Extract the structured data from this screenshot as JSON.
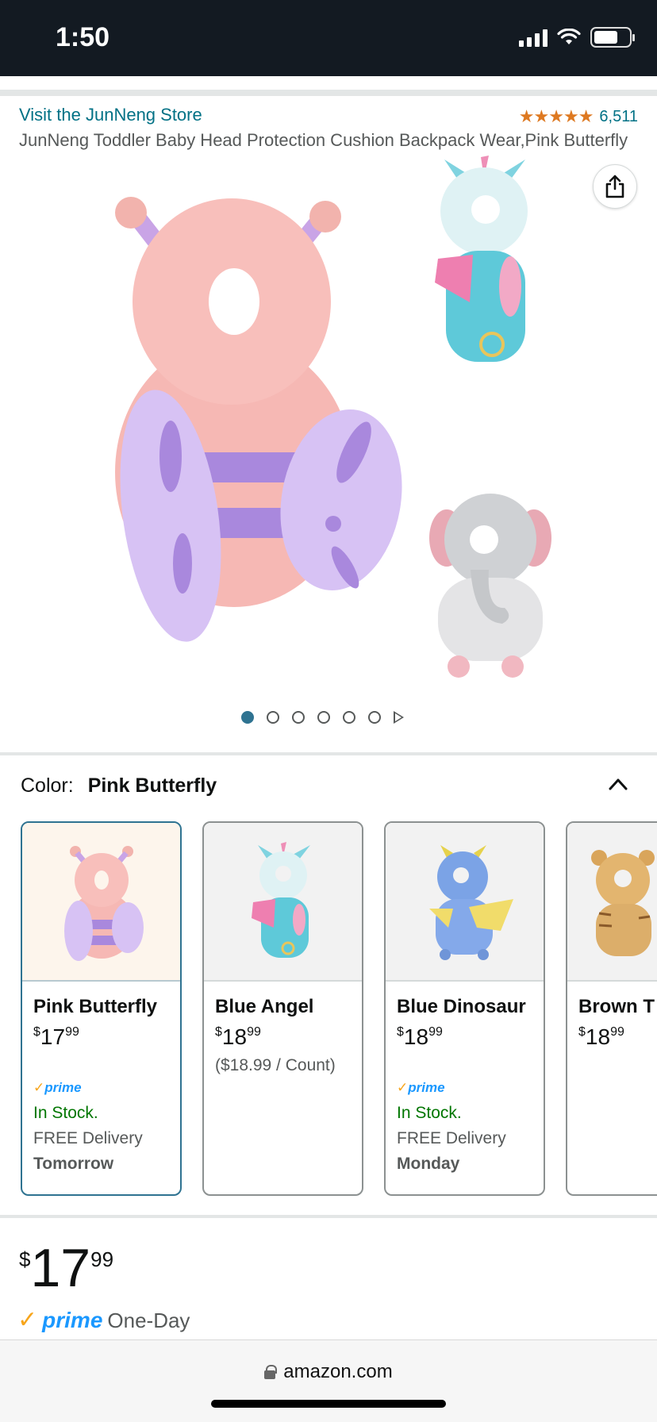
{
  "status_bar": {
    "time": "1:50"
  },
  "header": {
    "store_link": "Visit the JunNeng Store",
    "rating_count": "6,511",
    "rating_stars": "★★★★★",
    "product_title": "JunNeng Toddler Baby Head Protection Cushion Backpack Wear,Pink Butterfly"
  },
  "carousel": {
    "active_index": 1,
    "total_dots": 6
  },
  "color_selector": {
    "label": "Color:",
    "selected": "Pink Butterfly",
    "options": [
      {
        "name": "Pink Butterfly",
        "currency": "$",
        "whole": "17",
        "cents": "99",
        "unit_price": "",
        "prime": "prime",
        "stock": "In Stock.",
        "delivery": "FREE Delivery",
        "delivery_day": "Tomorrow"
      },
      {
        "name": "Blue Angel",
        "currency": "$",
        "whole": "18",
        "cents": "99",
        "unit_price": "($18.99 / Count)",
        "prime": "",
        "stock": "",
        "delivery": "",
        "delivery_day": ""
      },
      {
        "name": "Blue Dinosaur",
        "currency": "$",
        "whole": "18",
        "cents": "99",
        "unit_price": "",
        "prime": "prime",
        "stock": "In Stock.",
        "delivery": "FREE Delivery",
        "delivery_day": "Monday"
      },
      {
        "name": "Brown T",
        "currency": "$",
        "whole": "18",
        "cents": "99",
        "unit_price": "",
        "prime": "",
        "stock": "",
        "delivery": "",
        "delivery_day": ""
      }
    ]
  },
  "price": {
    "currency": "$",
    "whole": "17",
    "cents": "99"
  },
  "prime_line": {
    "check": "✓",
    "word": "prime",
    "label": "One-Day"
  },
  "url_bar": {
    "domain": "amazon.com"
  },
  "colors": {
    "link": "#007185",
    "star": "#de7921",
    "stock": "#007600",
    "prime_blue": "#1a98ff",
    "selected_border": "#2f7391"
  }
}
